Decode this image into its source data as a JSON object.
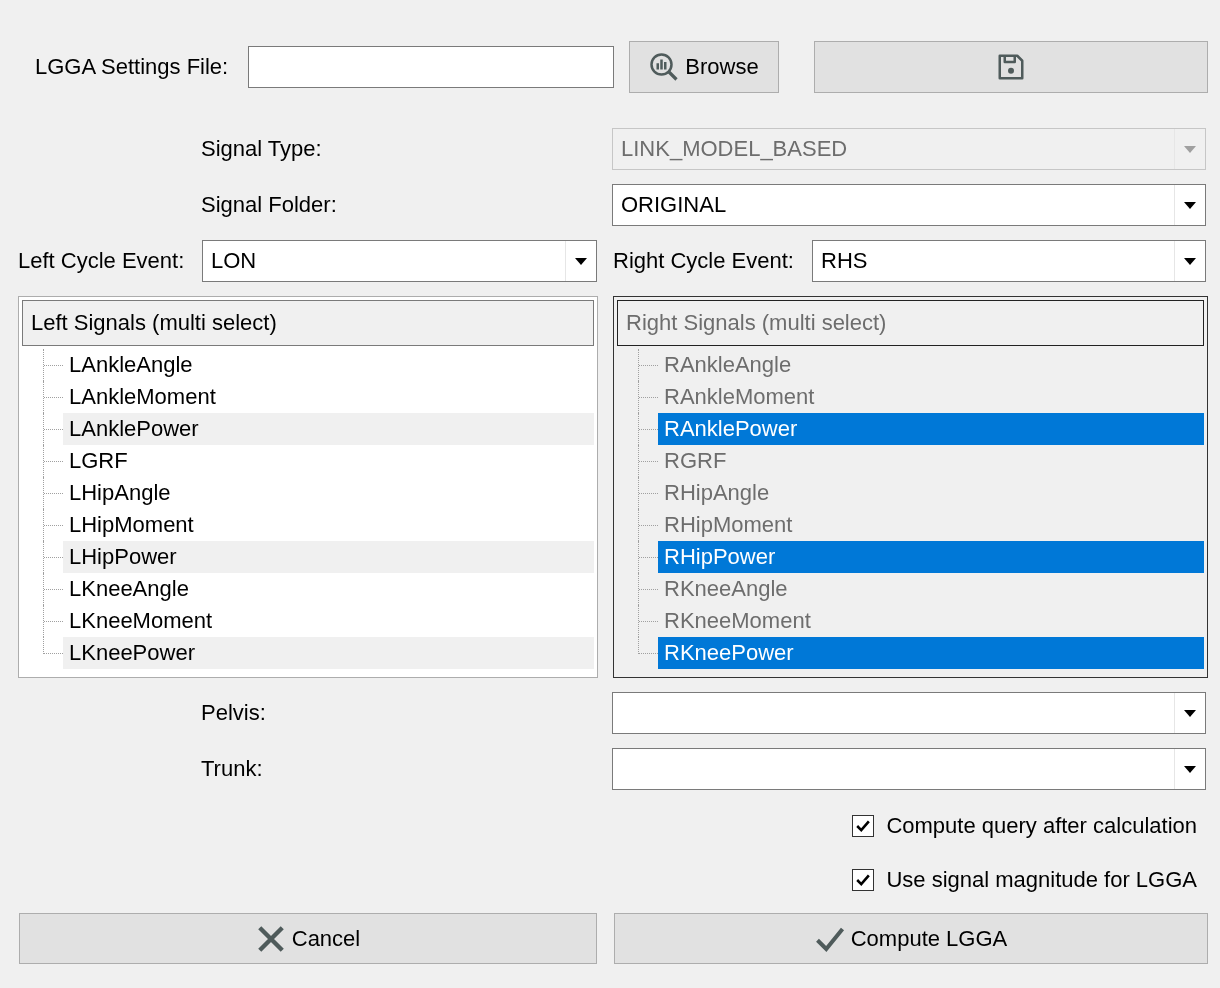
{
  "settings_file": {
    "label": "LGGA Settings File:",
    "browse_button": "Browse"
  },
  "signal_type": {
    "label": "Signal Type:",
    "value": "LINK_MODEL_BASED",
    "disabled": true
  },
  "signal_folder": {
    "label": "Signal Folder:",
    "value": "ORIGINAL",
    "disabled": false
  },
  "left_cycle_event": {
    "label": "Left Cycle Event:",
    "value": "LON",
    "disabled": false
  },
  "right_cycle_event": {
    "label": "Right Cycle Event:",
    "value": "RHS",
    "disabled": false
  },
  "left_signals": {
    "header": "Left Signals (multi select)",
    "disabled": false,
    "focused": false,
    "items": [
      {
        "label": "LAnkleAngle",
        "selected": false
      },
      {
        "label": "LAnkleMoment",
        "selected": false
      },
      {
        "label": "LAnklePower",
        "selected": true
      },
      {
        "label": "LGRF",
        "selected": false
      },
      {
        "label": "LHipAngle",
        "selected": false
      },
      {
        "label": "LHipMoment",
        "selected": false
      },
      {
        "label": "LHipPower",
        "selected": true
      },
      {
        "label": "LKneeAngle",
        "selected": false
      },
      {
        "label": "LKneeMoment",
        "selected": false
      },
      {
        "label": "LKneePower",
        "selected": true
      }
    ]
  },
  "right_signals": {
    "header": "Right Signals (multi select)",
    "disabled": true,
    "focused": true,
    "items": [
      {
        "label": "RAnkleAngle",
        "selected": false
      },
      {
        "label": "RAnkleMoment",
        "selected": false
      },
      {
        "label": "RAnklePower",
        "selected": true
      },
      {
        "label": "RGRF",
        "selected": false
      },
      {
        "label": "RHipAngle",
        "selected": false
      },
      {
        "label": "RHipMoment",
        "selected": false
      },
      {
        "label": "RHipPower",
        "selected": true
      },
      {
        "label": "RKneeAngle",
        "selected": false
      },
      {
        "label": "RKneeMoment",
        "selected": false
      },
      {
        "label": "RKneePower",
        "selected": true
      }
    ]
  },
  "pelvis": {
    "label": "Pelvis:",
    "disabled": false
  },
  "trunk": {
    "label": "Trunk:",
    "disabled": false
  },
  "checkboxes": [
    {
      "label": "Compute query after calculation",
      "checked": true
    },
    {
      "label": "Use signal magnitude for LGGA",
      "checked": true
    }
  ],
  "buttons": [
    {
      "label": "Cancel",
      "kind": "cancel"
    },
    {
      "label": "Compute LGGA",
      "kind": "confirm"
    }
  ]
}
